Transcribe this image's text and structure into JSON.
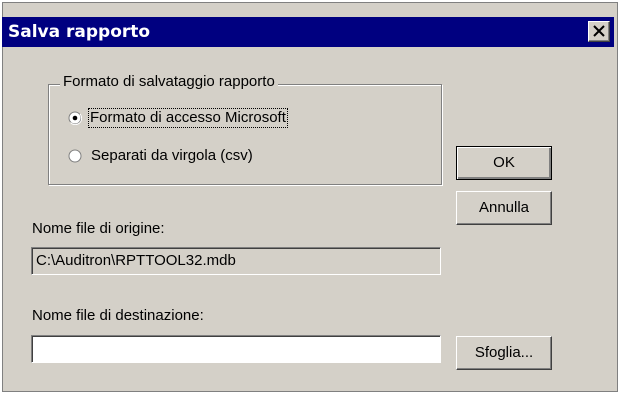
{
  "window": {
    "title": "Salva rapporto",
    "close_icon": "close-icon"
  },
  "format_group": {
    "legend": "Formato di salvataggio rapporto",
    "options": [
      {
        "label": "Formato di accesso Microsoft",
        "selected": true
      },
      {
        "label": "Separati da virgola (csv)",
        "selected": false
      }
    ]
  },
  "buttons": {
    "ok": "OK",
    "cancel": "Annulla",
    "browse": "Sfoglia..."
  },
  "source": {
    "label": "Nome file di origine:",
    "value": "C:\\Auditron\\RPTTOOL32.mdb"
  },
  "destination": {
    "label": "Nome file di destinazione:",
    "value": ""
  }
}
